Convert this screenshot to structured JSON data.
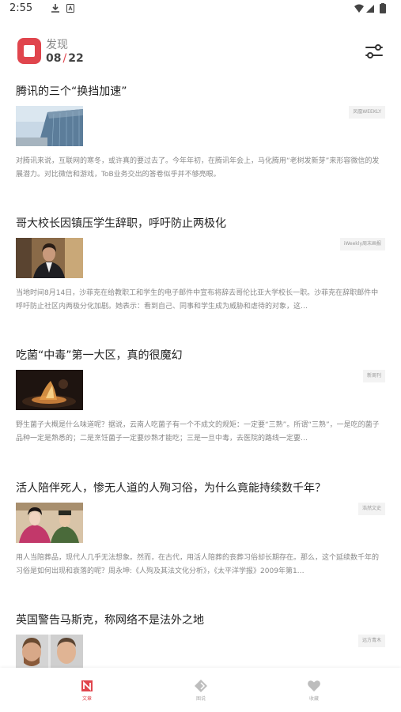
{
  "status_bar": {
    "time": "2:55"
  },
  "header": {
    "title": "发现",
    "date_month": "08",
    "date_day": "22",
    "accent": "#e0454d"
  },
  "articles": [
    {
      "title": "腾讯的三个“换挡加速”",
      "source": "凤凰WEEKLY",
      "excerpt": "对腾讯来说，互联网的寒冬，或许真的要过去了。今年年初，在腾讯年会上，马化腾用“老树发新芽”来形容微信的发展潜力。对比微信和游戏，ToB业务交出的答卷似乎并不够亮眼。",
      "thumb": "building-image"
    },
    {
      "title": "哥大校长因镇压学生辞职，呼吁防止两极化",
      "source": "iWeekly周末画报",
      "excerpt": "当地时间8月14日，沙菲克在给教职工和学生的电子邮件中宣布将辞去哥伦比亚大学校长一职。沙菲克在辞职邮件中呼吁防止社区内两极分化加剧。她表示：看到自己、同事和学生成为威胁和虐待的对象，这…",
      "thumb": "portrait-image"
    },
    {
      "title": "吃菌“中毒”第一大区，真的很魔幻",
      "source": "新周刊",
      "excerpt": "野生菌子大概是什么味道呢？据说，云南人吃菌子有一个不成文的规矩：一定要“三熟”。所谓“三熟”，一是吃的菌子品种一定是熟悉的；二是烹饪菌子一定要炒熟才能吃；三是一旦中毒，去医院的路线一定要…",
      "thumb": "cooking-image"
    },
    {
      "title": "活人陪伴死人，惨无人道的人殉习俗，为什么竟能持续数千年？",
      "source": "浩然文史",
      "excerpt": "用人当陪葬品，现代人几乎无法想象。然而，在古代，用活人陪葬的丧葬习俗却长期存在。那么，这个延续数千年的习俗是如何出现和衰落的呢？周永坤:《人殉及其法文化分析》，《太平洋学报》2009年第1…",
      "thumb": "drama-image"
    },
    {
      "title": "英国警告马斯克，称网络不是法外之地",
      "source": "远方青木",
      "excerpt": "",
      "thumb": "mugshots-image"
    }
  ],
  "bottom_nav": [
    {
      "label": "文章",
      "icon": "article-icon",
      "active": true
    },
    {
      "label": "图说",
      "icon": "picture-icon",
      "active": false
    },
    {
      "label": "收藏",
      "icon": "heart-icon",
      "active": false
    }
  ]
}
